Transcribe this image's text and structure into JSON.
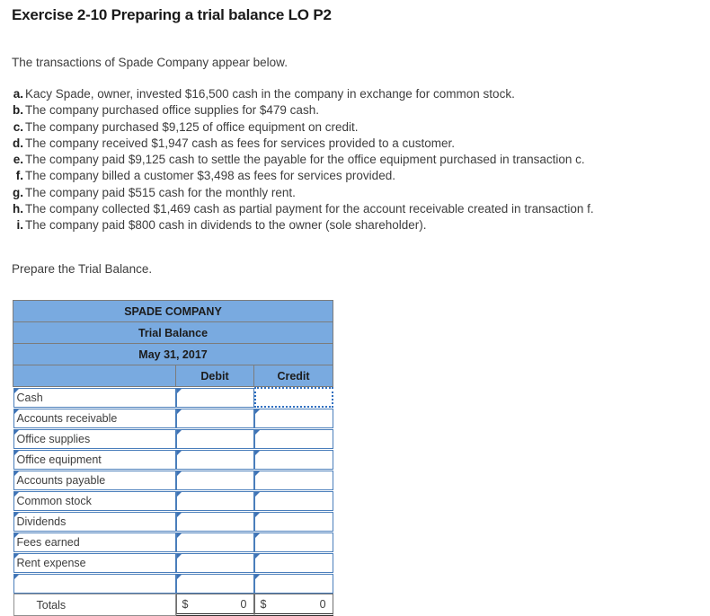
{
  "exercise": {
    "title": "Exercise 2-10 Preparing a trial balance LO P2",
    "intro": "The transactions of Spade Company appear below.",
    "prepare_instruction": "Prepare the Trial Balance."
  },
  "transactions": [
    {
      "letter": "a.",
      "text": "Kacy Spade, owner, invested $16,500 cash in the company in exchange for common stock.",
      "italic_suffix": ""
    },
    {
      "letter": "b.",
      "text": "The company purchased office supplies for $479 cash.",
      "italic_suffix": ""
    },
    {
      "letter": "c.",
      "text": "The company purchased $9,125 of office equipment on credit.",
      "italic_suffix": ""
    },
    {
      "letter": "d.",
      "text": "The company received $1,947 cash as fees for services provided to a customer.",
      "italic_suffix": ""
    },
    {
      "letter": "e.",
      "text": "The company paid $9,125 cash to settle the payable for the office equipment purchased in transaction ",
      "italic_suffix": "c."
    },
    {
      "letter": "f.",
      "text": "The company billed a customer $3,498 as fees for services provided.",
      "italic_suffix": ""
    },
    {
      "letter": "g.",
      "text": "The company paid $515 cash for the monthly rent.",
      "italic_suffix": ""
    },
    {
      "letter": "h.",
      "text": "The company collected $1,469 cash as partial payment for the account receivable created in transaction ",
      "italic_suffix": "f."
    },
    {
      "letter": "i.",
      "text": "The company paid $800 cash in dividends to the owner (sole shareholder).",
      "italic_suffix": ""
    }
  ],
  "trial_balance": {
    "header_lines": [
      "SPADE COMPANY",
      "Trial Balance",
      "May 31, 2017"
    ],
    "column_headers": {
      "account": "",
      "debit": "Debit",
      "credit": "Credit"
    },
    "rows": [
      {
        "account": "Cash",
        "debit": "",
        "credit": "",
        "credit_selected": true
      },
      {
        "account": "Accounts receivable",
        "debit": "",
        "credit": "",
        "credit_selected": false
      },
      {
        "account": "Office supplies",
        "debit": "",
        "credit": "",
        "credit_selected": false
      },
      {
        "account": "Office equipment",
        "debit": "",
        "credit": "",
        "credit_selected": false
      },
      {
        "account": "Accounts payable",
        "debit": "",
        "credit": "",
        "credit_selected": false
      },
      {
        "account": "Common stock",
        "debit": "",
        "credit": "",
        "credit_selected": false
      },
      {
        "account": "Dividends",
        "debit": "",
        "credit": "",
        "credit_selected": false
      },
      {
        "account": "Fees earned",
        "debit": "",
        "credit": "",
        "credit_selected": false
      },
      {
        "account": "Rent expense",
        "debit": "",
        "credit": "",
        "credit_selected": false
      },
      {
        "account": "",
        "debit": "",
        "credit": "",
        "credit_selected": false
      }
    ],
    "totals": {
      "label": "Totals",
      "debit_currency": "$",
      "debit_value": "0",
      "credit_currency": "$",
      "credit_value": "0"
    }
  },
  "colors": {
    "header_blue": "#79AAE0",
    "cell_border_blue": "#4A7EBB",
    "selection_blue": "#2F6FC0",
    "header_border_gray": "#7c7c7c",
    "text_gray": "#3d3d3d"
  }
}
